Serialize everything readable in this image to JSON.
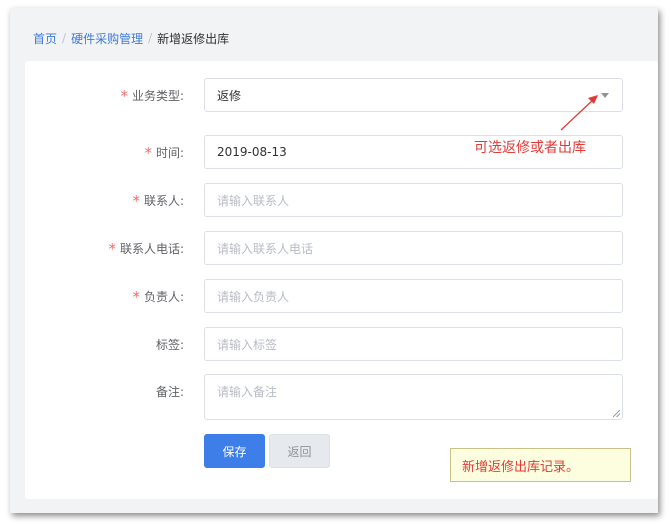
{
  "breadcrumb": {
    "home": "首页",
    "section": "硬件采购管理",
    "current": "新增返修出库",
    "separator": "/"
  },
  "form": {
    "business_type": {
      "label": "业务类型:",
      "required": true,
      "value": "返修"
    },
    "time": {
      "label": "时间:",
      "required": true,
      "value": "2019-08-13"
    },
    "contact": {
      "label": "联系人:",
      "required": true,
      "placeholder": "请输入联系人"
    },
    "contact_phone": {
      "label": "联系人电话:",
      "required": true,
      "placeholder": "请输入联系人电话"
    },
    "owner": {
      "label": "负责人:",
      "required": true,
      "placeholder": "请输入负责人"
    },
    "tags": {
      "label": "标签:",
      "required": false,
      "placeholder": "请输入标签"
    },
    "remark": {
      "label": "备注:",
      "required": false,
      "placeholder": "请输入备注"
    },
    "required_mark": "*"
  },
  "buttons": {
    "save": "保存",
    "back": "返回"
  },
  "annotations": {
    "type_hint": "可选返修或者出库",
    "caption": "新增返修出库记录。"
  },
  "colors": {
    "primary": "#3d7ee8",
    "required": "#f56c6c",
    "annotation": "#e23b36",
    "link": "#3f7bd6"
  }
}
